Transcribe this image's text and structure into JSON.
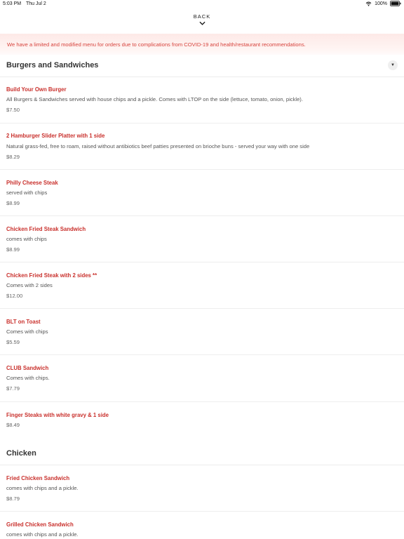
{
  "status_bar": {
    "time": "5:03 PM",
    "date": "Thu Jul 2",
    "battery": "100%",
    "wifi_icon": "wifi-icon",
    "battery_icon": "battery-icon"
  },
  "nav": {
    "back_label": "BACK",
    "back_icon": "chevron-down-icon"
  },
  "banner": {
    "text": "We have a limited and modified menu for orders due to complications from COVID-19 and health/restaurant recommendations."
  },
  "colors": {
    "accent": "#c9302c",
    "banner_text": "#d7443e",
    "banner_bg": "#fde9e7"
  },
  "sections": [
    {
      "title": "Burgers and Sandwiches",
      "collapse_icon": "caret-down-icon",
      "items": [
        {
          "name": "Build Your Own Burger",
          "desc": "All Burgers & Sandwiches served with house chips and a pickle. Comes with LTOP on the side (lettuce, tomato, onion, pickle).",
          "price": "$7.50"
        },
        {
          "name": "2 Hamburger Slider Platter with 1 side",
          "desc": "Natural grass-fed, free to roam, raised without antibiotics beef patties presented on brioche buns - served your way with one side",
          "price": "$8.29"
        },
        {
          "name": "Philly Cheese Steak",
          "desc": "served with chips",
          "price": "$8.99"
        },
        {
          "name": "Chicken Fried Steak Sandwich",
          "desc": "comes with chips",
          "price": "$8.99"
        },
        {
          "name": "Chicken Fried Steak with 2 sides **",
          "desc": "Comes with 2 sides",
          "price": "$12.00"
        },
        {
          "name": "BLT on Toast",
          "desc": "Comes with chips",
          "price": "$5.59"
        },
        {
          "name": "CLUB Sandwich",
          "desc": "Comes with chips.",
          "price": "$7.79"
        },
        {
          "name": "Finger Steaks with white gravy & 1 side",
          "desc": "",
          "price": "$8.49"
        }
      ]
    },
    {
      "title": "Chicken",
      "items": [
        {
          "name": "Fried Chicken Sandwich",
          "desc": "comes with chips and a pickle.",
          "price": "$8.79"
        },
        {
          "name": "Grilled Chicken Sandwich",
          "desc": "comes with chips and a pickle.",
          "price": ""
        }
      ]
    }
  ]
}
